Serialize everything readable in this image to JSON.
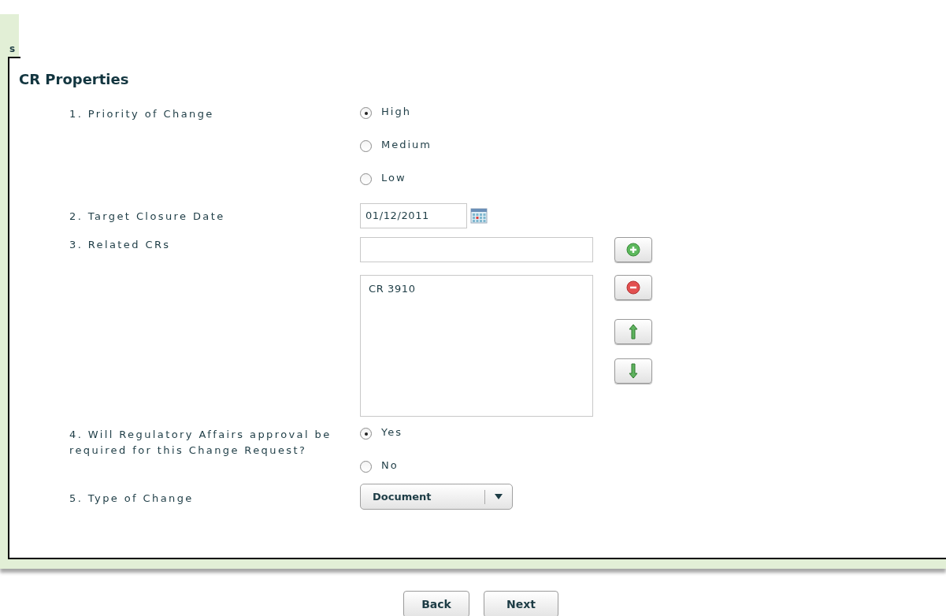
{
  "tab": {
    "label": "s"
  },
  "section": {
    "title": "CR Properties"
  },
  "questions": [
    {
      "kind": "radio",
      "label": "1. Priority of Change",
      "options": [
        {
          "label": "High",
          "selected": true
        },
        {
          "label": "Medium",
          "selected": false
        },
        {
          "label": "Low",
          "selected": false
        }
      ]
    },
    {
      "kind": "date",
      "label": "2. Target Closure Date",
      "value": "01/12/2011"
    },
    {
      "kind": "list",
      "label": "3. Related CRs",
      "items": [
        "CR 3910"
      ]
    },
    {
      "kind": "radio",
      "label": "4. Will Regulatory Affairs approval be required for this Change Request?",
      "options": [
        {
          "label": "Yes",
          "selected": true
        },
        {
          "label": "No",
          "selected": false
        }
      ]
    },
    {
      "kind": "dropdown",
      "label": "5. Type of Change",
      "value": "Document"
    }
  ],
  "buttons": [
    "Back",
    "Next"
  ]
}
